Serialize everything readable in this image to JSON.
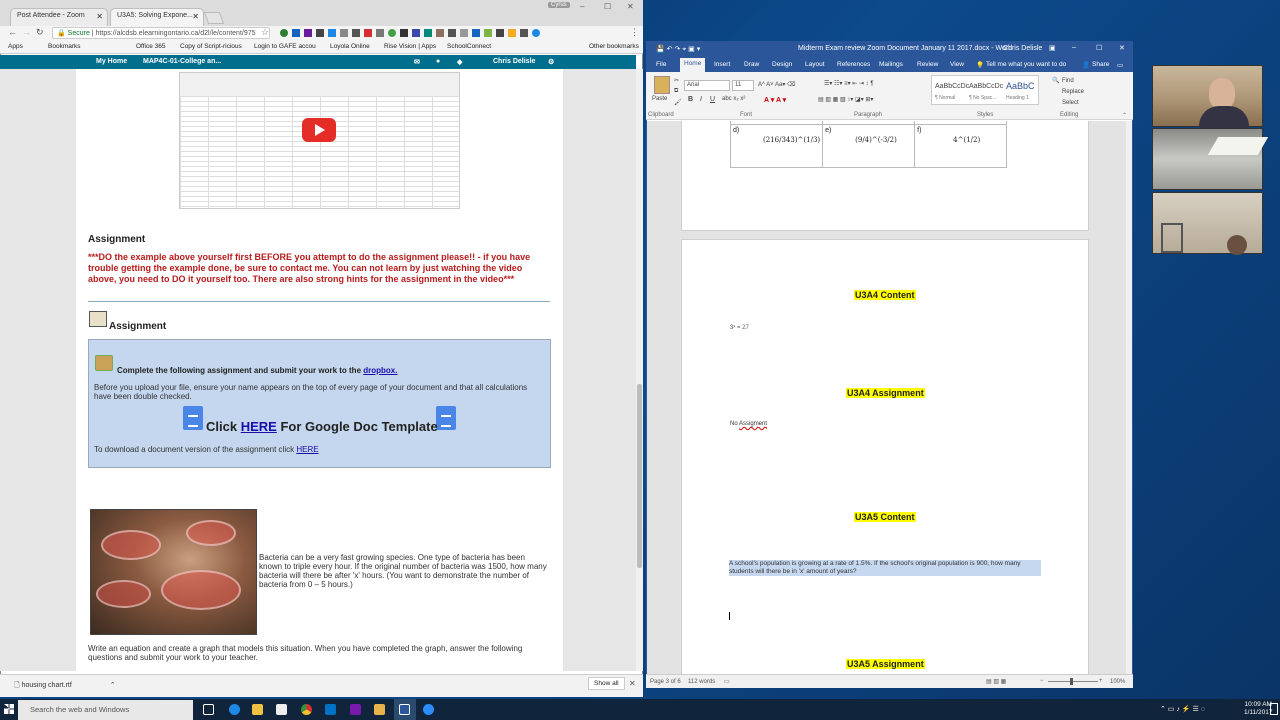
{
  "browser": {
    "tabs": [
      {
        "label": "Post Attendee - Zoom"
      },
      {
        "label": "U3A5: Solving Expone..."
      }
    ],
    "url_secure": "Secure",
    "url": "https://alcdsb.elearningontario.ca/d2l/le/content/975",
    "profile_badge": "Cyrus",
    "bookmarks": [
      "Apps",
      "Bookmarks",
      "Office 365",
      "Copy of Script-ricious",
      "Login to GAFE accou",
      "Loyola Online",
      "Rise Vision | Apps",
      "SchoolConnect",
      "Other bookmarks"
    ],
    "nav": {
      "home": "My Home",
      "course": "MAP4C-01-College an...",
      "user": "Chris Delisle"
    }
  },
  "lesson": {
    "assignment_heading": "Assignment",
    "warning_text": "***DO the example above yourself first BEFORE you attempt to do the assignment please!! - if you have trouble getting the example done, be sure to contact me.  You can not learn by just watching the video above, you need to DO it yourself too.  There are also strong hints for the assignment in the video***",
    "assignment_label": "Assignment",
    "box": {
      "instruction": "Complete the following assignment and submit your work to the",
      "dropbox_link": "dropbox.",
      "note": "Before you upload your file, ensure your name appears on the top of every page of your document and that all calculations have been double checked.",
      "click_text": "Click",
      "here_link": "HERE",
      "template_text": "For Google Doc Template",
      "download_text": "To download a document version of the assignment click",
      "download_link": "HERE"
    },
    "bacteria_text": "Bacteria can be a very fast growing species. One type of bacteria has been known to triple every hour. If the original number of bacteria was 1500, how many bacteria will there be after 'x' hours. (You want to demonstrate the number of bacteria from 0 – 5 hours.)",
    "graph_text": "Write an equation and create a graph that models this situation. When you have completed the graph, answer the following questions and submit your work to your teacher."
  },
  "downloads": {
    "file": "housing chart.rtf",
    "show_all": "Show all"
  },
  "word": {
    "title": "Midterm Exam review Zoom Document January 11 2017.docx  -  Word",
    "user": "Chris Delisle",
    "tabs": [
      "File",
      "Home",
      "Insert",
      "Draw",
      "Design",
      "Layout",
      "References",
      "Mailings",
      "Review",
      "View"
    ],
    "tell_me": "Tell me what you want to do",
    "share": "Share",
    "font_name": "Arial",
    "font_size": "11",
    "styles": [
      {
        "sample": "AaBbCcDc",
        "name": "¶ Normal"
      },
      {
        "sample": "AaBbCcDc",
        "name": "¶ No Spac..."
      },
      {
        "sample": "AaBbC",
        "name": "Heading 1"
      }
    ],
    "editing": [
      "Find",
      "Replace",
      "Select"
    ],
    "groups": [
      "Clipboard",
      "Font",
      "Paragraph",
      "Styles",
      "Editing"
    ],
    "paste": "Paste",
    "table_cells": [
      {
        "label": "d)",
        "expr": "(216/343)^(1/3)"
      },
      {
        "label": "e)",
        "expr": "(9/4)^(-3/2)"
      },
      {
        "label": "f)",
        "expr": "4^(1/2)"
      }
    ],
    "sections": {
      "u3a4_content": "U3A4 Content",
      "equation": "3ˣ = 27",
      "u3a4_assignment": "U3A4 Assignment",
      "no_assignment": "No",
      "no_assignment_word": "Assigment",
      "u3a5_content": "U3A5 Content",
      "question": "A school's population is growing at a rate of 1.5%. If the school's original population is 900, how many students will there be in 'x' amount of years?",
      "u3a5_assignment": "U3A5 Assignment"
    },
    "status": {
      "page": "Page 3 of 6",
      "words": "112 words",
      "zoom": "100%"
    }
  },
  "taskbar": {
    "search_placeholder": "Search the web and Windows",
    "time": "10:09 AM",
    "date": "1/11/2017"
  },
  "colors": {
    "nav_teal": "#006f8e",
    "word_blue": "#2b579a",
    "warning_red": "#b71c1c",
    "highlight_yellow": "#ffff00"
  }
}
